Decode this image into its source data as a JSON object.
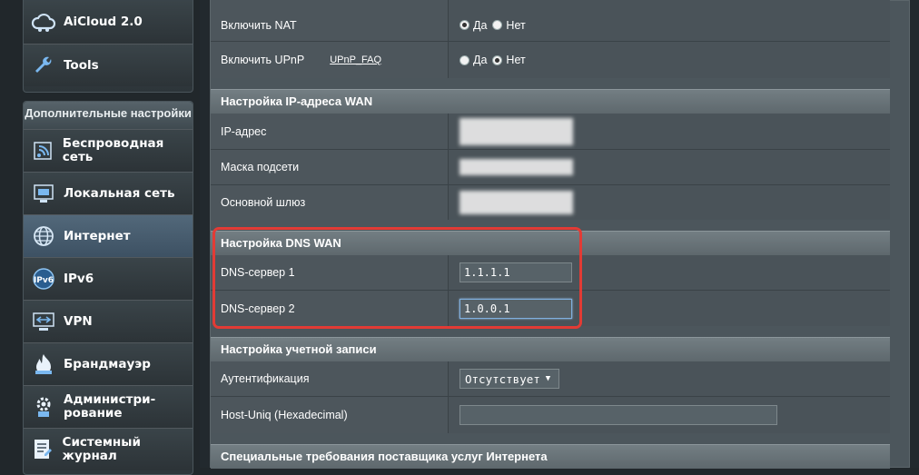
{
  "sidebar": {
    "top_items": [
      {
        "label": "AiCloud 2.0",
        "icon": "cloud-icon"
      },
      {
        "label": "Tools",
        "icon": "wrench-icon"
      }
    ],
    "advanced_header": "Дополнительные настройки",
    "items": [
      {
        "label": "Беспроводная сеть",
        "icon": "wireless-icon"
      },
      {
        "label": "Локальная сеть",
        "icon": "lan-icon"
      },
      {
        "label": "Интернет",
        "icon": "globe-icon",
        "active": true
      },
      {
        "label": "IPv6",
        "icon": "ipv6-icon"
      },
      {
        "label": "VPN",
        "icon": "vpn-icon"
      },
      {
        "label": "Брандмауэр",
        "icon": "firewall-icon"
      },
      {
        "label": "Администри-\nрование",
        "icon": "admin-gear-icon"
      },
      {
        "label": "Системный журнал",
        "icon": "system-log-icon"
      }
    ]
  },
  "nat": {
    "label": "Включить NAT",
    "options": [
      "Да",
      "Нет"
    ],
    "selected": "Да"
  },
  "upnp": {
    "label": "Включить UPnP",
    "faq_link": "UPnP_FAQ",
    "options": [
      "Да",
      "Нет"
    ],
    "selected": "Нет"
  },
  "wan_ip": {
    "title": "Настройка IP-адреса WAN",
    "ip_label": "IP-адрес",
    "mask_label": "Маска подсети",
    "gateway_label": "Основной шлюз"
  },
  "dns": {
    "title": "Настройка DNS WAN",
    "dns1_label": "DNS-сервер 1",
    "dns1_value": "1.1.1.1",
    "dns2_label": "DNS-сервер 2",
    "dns2_value": "1.0.0.1"
  },
  "account": {
    "title": "Настройка учетной записи",
    "auth_label": "Аутентификация",
    "auth_value": "Отсутствует",
    "host_uniq_label": "Host-Uniq (Hexadecimal)",
    "host_uniq_value": ""
  },
  "isp": {
    "title": "Специальные требования поставщика услуг Интернета"
  },
  "colors": {
    "highlight": "#e23b35",
    "active_nav": "#4a6072"
  }
}
